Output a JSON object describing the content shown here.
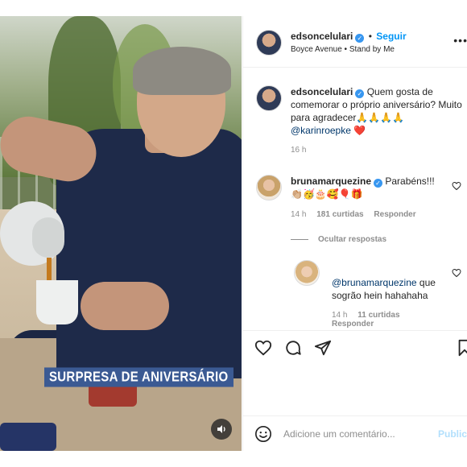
{
  "media": {
    "caption_banner": "SURPRESA DE ANIVERSÁRIO",
    "sound_icon": "speaker-icon"
  },
  "header": {
    "username": "edsoncelulari",
    "separator": "•",
    "follow_label": "Seguir",
    "audio": "Boyce Avenue • Stand by Me",
    "more_icon": "more-options-icon"
  },
  "post": {
    "username": "edsoncelulari",
    "caption": "Quem gosta de comemorar o próprio aniversário? Muito para agradecer🙏🙏🙏🙏",
    "mention": "@karinroepke",
    "heart": "❤️",
    "time": "16 h"
  },
  "comments": [
    {
      "username": "brunamarquezine",
      "text": "Parabéns!!!",
      "emojis": "👏🏼🥳🎂🥰🎈🎁",
      "time": "14 h",
      "likes": "181 curtidas",
      "reply_label": "Responder",
      "hide_replies": "Ocultar respostas"
    },
    {
      "mention": "@brunamarquezine",
      "text": " que sogrão hein hahahaha",
      "time": "14 h",
      "likes": "11 curtidas",
      "reply_label": "Responder"
    }
  ],
  "actions": {
    "like_icon": "heart-icon",
    "comment_icon": "comment-icon",
    "share_icon": "share-icon",
    "save_icon": "bookmark-icon"
  },
  "add_comment": {
    "placeholder": "Adicione um comentário...",
    "publish_label": "Publicar"
  }
}
